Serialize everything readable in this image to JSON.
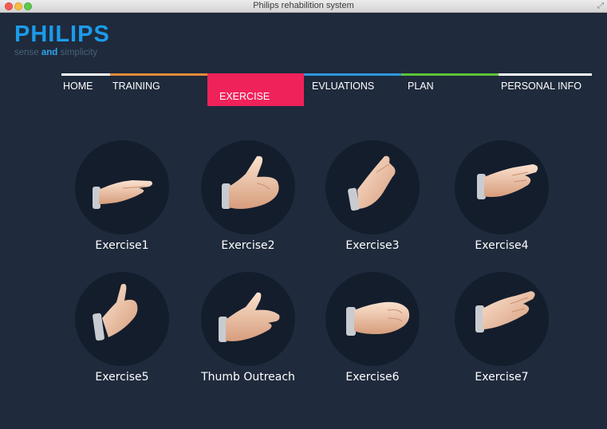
{
  "window": {
    "title": "Philips rehabilition system"
  },
  "brand": {
    "name": "PHILIPS",
    "tagline_part1": "sense",
    "tagline_and": "and",
    "tagline_part2": "simplicity"
  },
  "nav": [
    {
      "label": "HOME",
      "color": "#ffffff",
      "active": false
    },
    {
      "label": "TRAINING",
      "color": "#e6893a",
      "active": false
    },
    {
      "label": "EXERCISE",
      "color": "#f0225a",
      "active": true
    },
    {
      "label": "EVLUATIONS",
      "color": "#2e97dd",
      "active": false
    },
    {
      "label": "PLAN",
      "color": "#5cc437",
      "active": false
    },
    {
      "label": "PERSONAL INFO",
      "color": "#ffffff",
      "active": false
    }
  ],
  "exercises": [
    {
      "label": "Exercise1",
      "icon": "flat-hand-icon"
    },
    {
      "label": "Exercise2",
      "icon": "thumbs-up-hand-icon"
    },
    {
      "label": "Exercise3",
      "icon": "raised-hand-icon"
    },
    {
      "label": "Exercise4",
      "icon": "pinch-hand-icon"
    },
    {
      "label": "Exercise5",
      "icon": "thumb-fist-hand-icon"
    },
    {
      "label": "Thumb Outreach",
      "icon": "thumb-outreach-hand-icon"
    },
    {
      "label": "Exercise6",
      "icon": "fist-hand-icon"
    },
    {
      "label": "Exercise7",
      "icon": "finger-curl-hand-icon"
    }
  ]
}
